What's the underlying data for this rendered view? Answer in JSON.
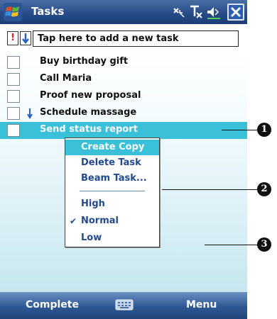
{
  "titlebar": {
    "title": "Tasks",
    "icons": [
      "windows-start-icon",
      "connectivity-icon",
      "signal-off-icon",
      "speaker-icon",
      "close-icon"
    ]
  },
  "entrybar": {
    "priority_high": "!",
    "placeholder": "Tap here to add a new task"
  },
  "tasks": [
    {
      "label": "Buy birthday gift",
      "priority": "normal",
      "selected": false
    },
    {
      "label": "Call Maria",
      "priority": "normal",
      "selected": false
    },
    {
      "label": "Proof new proposal",
      "priority": "normal",
      "selected": false
    },
    {
      "label": "Schedule massage",
      "priority": "low",
      "selected": false
    },
    {
      "label": "Send status report",
      "priority": "normal",
      "selected": true
    }
  ],
  "context_menu": {
    "items": [
      {
        "label": "Create Copy",
        "highlighted": true,
        "checked": false
      },
      {
        "label": "Delete Task",
        "highlighted": false,
        "checked": false
      },
      {
        "label": "Beam Task...",
        "highlighted": false,
        "checked": false
      },
      {
        "label": "High",
        "highlighted": false,
        "checked": false
      },
      {
        "label": "Normal",
        "highlighted": false,
        "checked": true
      },
      {
        "label": "Low",
        "highlighted": false,
        "checked": false
      }
    ],
    "check_symbol": "✔"
  },
  "bottombar": {
    "left_softkey": "Complete",
    "right_softkey": "Menu"
  },
  "callouts": [
    "1",
    "2",
    "3"
  ],
  "colors": {
    "highlight": "#3ac0d8",
    "menu_text": "#234a8c",
    "titlebar": "#244a86",
    "high_priority": "#e02020",
    "low_priority": "#2a5fc0"
  }
}
